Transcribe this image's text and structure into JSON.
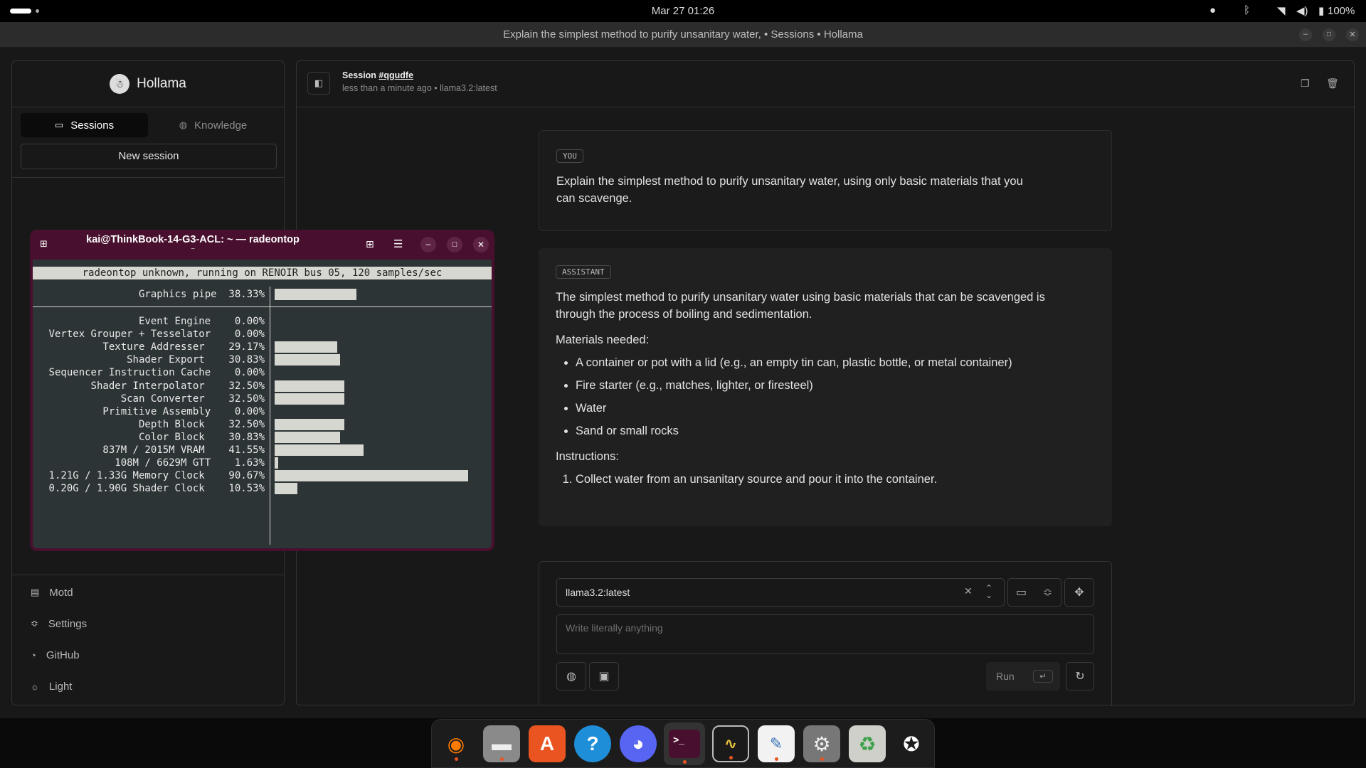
{
  "topbar": {
    "datetime": "Mar 27  01:26",
    "battery": "100%"
  },
  "window_title": "Explain the simplest method to purify unsanitary water, • Sessions • Hollama",
  "sidebar": {
    "app_name": "Hollama",
    "tabs": [
      {
        "label": "Sessions",
        "active": true
      },
      {
        "label": "Knowledge",
        "active": false
      }
    ],
    "new_session": "New session",
    "nav": [
      {
        "label": "Motd",
        "icon": "document-icon"
      },
      {
        "label": "Settings",
        "icon": "settings-icon"
      },
      {
        "label": "GitHub",
        "icon": "github-icon"
      },
      {
        "label": "Light",
        "icon": "sun-icon"
      }
    ]
  },
  "session": {
    "title_prefix": "Session ",
    "id": "#qgudfe",
    "meta": "less than a minute ago • llama3.2:latest"
  },
  "messages": {
    "user": {
      "role": "YOU",
      "text": "Explain the simplest method to purify unsanitary water, using only basic materials that you can scavenge."
    },
    "assistant": {
      "role": "ASSISTANT",
      "intro": "The simplest method to purify unsanitary water using basic materials that can be scavenged is through the process of boiling and sedimentation.",
      "materials_heading": "Materials needed:",
      "materials": [
        "A container or pot with a lid (e.g., an empty tin can, plastic bottle, or metal container)",
        "Fire starter (e.g., matches, lighter, or firesteel)",
        "Water",
        "Sand or small rocks"
      ],
      "instructions_heading": "Instructions:",
      "instructions": [
        "Collect water from an unsanitary source and pour it into the container."
      ]
    }
  },
  "composer": {
    "model": "llama3.2:latest",
    "placeholder": "Write literally anything",
    "run_label": "Run",
    "enter_key": "↵"
  },
  "terminal": {
    "title": "kai@ThinkBook-14-G3-ACL: ~ — radeontop",
    "subtitle": "~",
    "header_line": "radeontop unknown, running on RENOIR bus 05, 120 samples/sec",
    "graphics_pipe": {
      "label": "Graphics pipe",
      "pct": "38.33%",
      "value": 38.33
    },
    "rows": [
      {
        "label": "Event Engine",
        "pct": "0.00%",
        "value": 0
      },
      {
        "label": "Vertex Grouper + Tesselator",
        "pct": "0.00%",
        "value": 0
      },
      {
        "label": "Texture Addresser",
        "pct": "29.17%",
        "value": 29.17
      },
      {
        "label": "Shader Export",
        "pct": "30.83%",
        "value": 30.83
      },
      {
        "label": "Sequencer Instruction Cache",
        "pct": "0.00%",
        "value": 0
      },
      {
        "label": "Shader Interpolator",
        "pct": "32.50%",
        "value": 32.5
      },
      {
        "label": "Scan Converter",
        "pct": "32.50%",
        "value": 32.5
      },
      {
        "label": "Primitive Assembly",
        "pct": "0.00%",
        "value": 0
      },
      {
        "label": "Depth Block",
        "pct": "32.50%",
        "value": 32.5
      },
      {
        "label": "Color Block",
        "pct": "30.83%",
        "value": 30.83
      },
      {
        "label": "837M / 2015M VRAM",
        "pct": "41.55%",
        "value": 41.55
      },
      {
        "label": "108M / 6629M GTT",
        "pct": "1.63%",
        "value": 1.63
      },
      {
        "label": "1.21G / 1.33G Memory Clock",
        "pct": "90.67%",
        "value": 90.67
      },
      {
        "label": "0.20G / 1.90G Shader Clock",
        "pct": "10.53%",
        "value": 10.53
      }
    ]
  },
  "dock": [
    "firefox-icon",
    "files-icon",
    "app-center-icon",
    "help-icon",
    "discord-icon",
    "terminal-icon",
    "system-monitor-icon",
    "text-editor-icon",
    "settings-icon",
    "trash-icon",
    "ubuntu-icon"
  ],
  "colors": {
    "terminal_frame": "#48102e",
    "terminal_bg": "#2d3436",
    "accent": "#e95420"
  }
}
